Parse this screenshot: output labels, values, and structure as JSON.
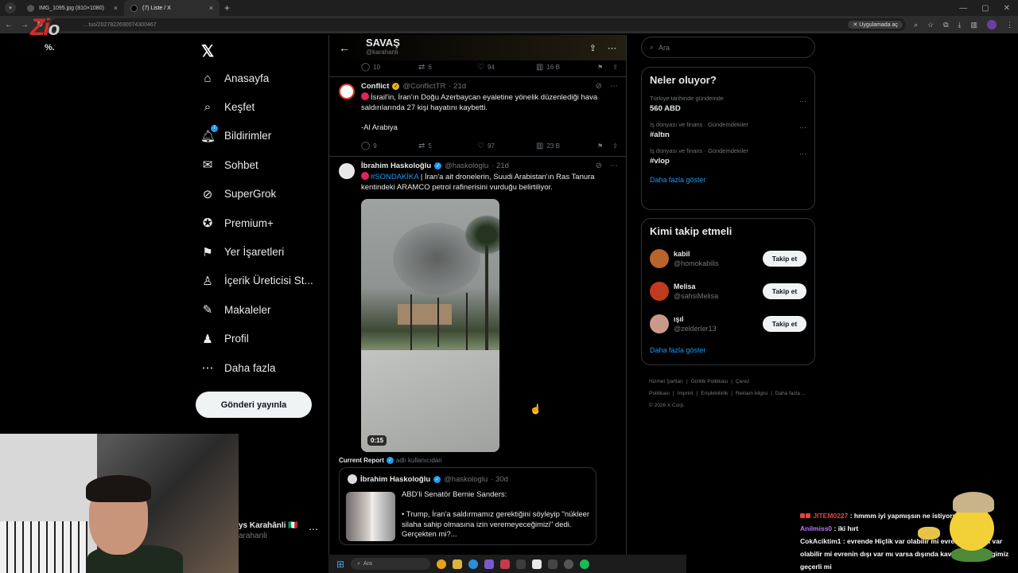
{
  "browser": {
    "tabs": [
      {
        "label": "IMG_1095.jpg (810×1080)"
      },
      {
        "label": "(7) Liste / X"
      }
    ],
    "url": "…tus/2027822690074300467",
    "app_chip": "Uygulamada aç"
  },
  "overlay_logo": {
    "main": "Zi",
    "accent": "o",
    "sub": "%."
  },
  "nav": {
    "items": [
      {
        "label": "Anasayfa",
        "icon": "home-icon",
        "glyph": "⌂"
      },
      {
        "label": "Keşfet",
        "icon": "search-icon",
        "glyph": "⌕"
      },
      {
        "label": "Bildirimler",
        "icon": "bell-icon",
        "glyph": "🔔︎",
        "badge": "7"
      },
      {
        "label": "Sohbet",
        "icon": "mail-icon",
        "glyph": "✉"
      },
      {
        "label": "SuperGrok",
        "icon": "grok-icon",
        "glyph": "⊘"
      },
      {
        "label": "Premium+",
        "icon": "verified-icon",
        "glyph": "✪"
      },
      {
        "label": "Yer İşaretleri",
        "icon": "bookmark-icon",
        "glyph": "⚑"
      },
      {
        "label": "İçerik Üreticisi St...",
        "icon": "creator-icon",
        "glyph": "♙"
      },
      {
        "label": "Makaleler",
        "icon": "articles-icon",
        "glyph": "✎"
      },
      {
        "label": "Profil",
        "icon": "profile-icon",
        "glyph": "♟"
      },
      {
        "label": "Daha fazla",
        "icon": "more-icon",
        "glyph": "⋯"
      }
    ],
    "post_button": "Gönderi yayınla"
  },
  "account": {
    "name": "ys Karahânli 🇮🇹",
    "handle": "arahanli"
  },
  "list_header": {
    "title": "SAVAŞ",
    "subtitle": "@karahanli"
  },
  "top_actions": {
    "replies": "10",
    "reposts": "6",
    "likes": "94",
    "views": "16 B"
  },
  "tweets": [
    {
      "name": "Conflict",
      "handle": "@ConflictTR",
      "time": "· 21d",
      "text_line1": "İsrail'in, İran'ın Doğu Azerbaycan eyaletine yönelik düzenlediği hava saldırılarında 27 kişi hayatını kaybetti.",
      "text_line2": "-Al Arabiya",
      "replies": "9",
      "reposts": "5",
      "likes": "97",
      "views": "23 B"
    },
    {
      "name": "İbrahim Haskoloğlu",
      "handle": "@haskologlu",
      "time": "· 21d",
      "hashtag": "#SONDAKİKA",
      "text": " | İran'a ait dronelerin, Suudi Arabistan'ın Ras Tanura kentindeki ARAMCO petrol rafinerisini vurduğu belirtiliyor.",
      "video_duration": "0:15",
      "community_label": "Current Report",
      "community_by": "adlı kullanıcıdan",
      "quote": {
        "name": "İbrahim Haskoloğlu",
        "handle": "@haskologlu",
        "time": "· 30d",
        "title": "ABD'li Senatör Bernie Sanders:",
        "text": "• Trump, İran'a saldırmamız gerektiğini söyleyip \"nükleer silaha sahip olmasına izin veremeyeceğimizi\" dedi. Gerçekten mi?..."
      }
    }
  ],
  "search": {
    "placeholder": "Ara"
  },
  "trends": {
    "title": "Neler oluyor?",
    "items": [
      {
        "context": "Türkiye tarihinde gündemde",
        "topic": "560 ABD"
      },
      {
        "context": "İş dünyası ve finans · Gündemdekiler",
        "topic": "#altın"
      },
      {
        "context": "İş dünyası ve finans · Gündemdekiler",
        "topic": "#vlop"
      }
    ],
    "show_more": "Daha fazla göster"
  },
  "who_to_follow": {
    "title": "Kimi takip etmeli",
    "items": [
      {
        "name": "kabil",
        "handle": "@homokabilis",
        "button": "Takip et",
        "color": "#b8642a"
      },
      {
        "name": "Melisa",
        "handle": "@sahsiMelisa",
        "button": "Takip et",
        "color": "#c23a1e"
      },
      {
        "name": "ışıl",
        "handle": "@zelderler13",
        "button": "Takip et",
        "color": "#c99a8a"
      }
    ],
    "show_more": "Daha fazla göster"
  },
  "footer": {
    "links": [
      "Hizmet Şartları",
      "|",
      "Gizlilik Politikası",
      "|",
      "Çerez Politikası",
      "|",
      "Imprint",
      "|",
      "Erişilebilirlik",
      "|",
      "Reklam bilgisi",
      "|",
      "Daha fazla ..."
    ],
    "copyright": "© 2026 X Corp."
  },
  "chat": [
    {
      "user": "JITEM0227",
      "message": " : hmmm iyi yapmışsın ne istiyorsun"
    },
    {
      "user": "Anilmiss0",
      "message": " : iki hırt"
    },
    {
      "user": "CokAciktim1",
      "message": " : evrende Hiçlik var olabilir mi evrenin dışında var olabilir mi evrenin dışı var mı varsa dışında kavramlar ve bilgimiz geçerli mi"
    }
  ],
  "taskbar": {
    "search": "Ara"
  }
}
